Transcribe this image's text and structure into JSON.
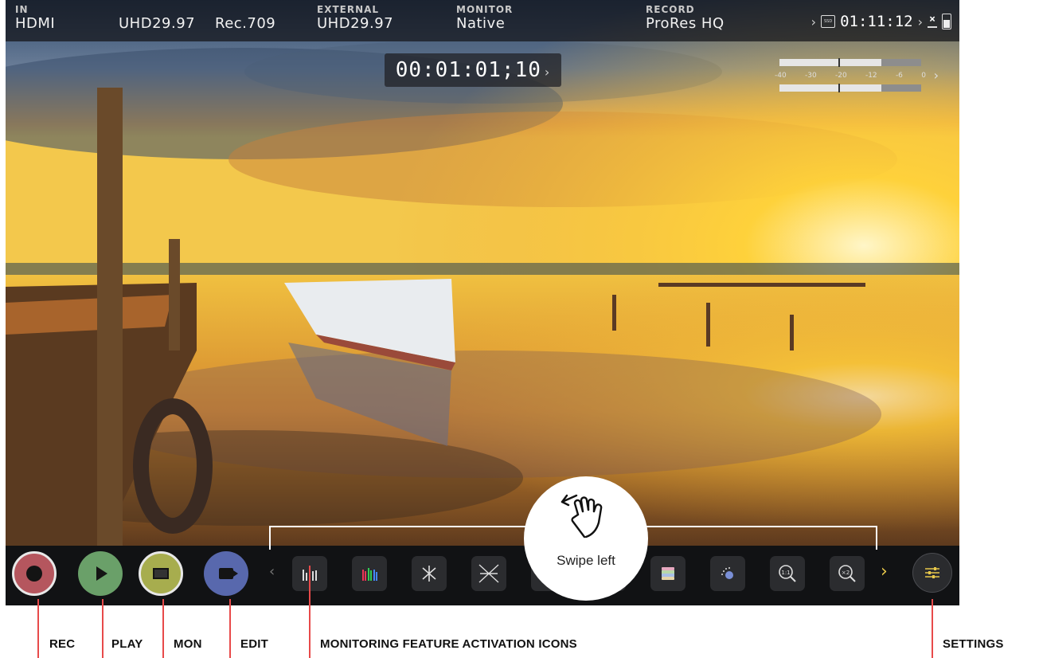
{
  "topbar": {
    "input": {
      "label": "IN",
      "value": "HDMI"
    },
    "format": {
      "value": "UHD29.97"
    },
    "gamma": {
      "value": "Rec.709"
    },
    "external": {
      "label": "EXTERNAL",
      "value": "UHD29.97"
    },
    "monitor": {
      "label": "MONITOR",
      "value": "Native"
    },
    "record": {
      "label": "RECORD",
      "value": "ProRes HQ"
    },
    "media": {
      "badge": "SSD",
      "remaining": "01:11:12"
    }
  },
  "timecode": {
    "value": "00:01:01;10"
  },
  "audio_meters": {
    "scale": [
      "-40",
      "-30",
      "-20",
      "-12",
      "-6",
      "0"
    ],
    "level_fraction": [
      0.72,
      0.72
    ]
  },
  "bottombar": {
    "modes": [
      {
        "id": "rec",
        "color": "#b5565e"
      },
      {
        "id": "play",
        "color": "#6aa069"
      },
      {
        "id": "mon",
        "color": "#a7ad4e"
      },
      {
        "id": "edit",
        "color": "#5868ad"
      }
    ],
    "monitoring_icons": [
      "waveform-icon",
      "vectorscope-rgb-icon",
      "false-color-icon",
      "zebra-icon",
      "histogram-icon",
      "focus-peaking-icon",
      "color-bars-icon",
      "dot-focus-icon",
      "zoom-1to1-icon",
      "zoom-x2-icon"
    ],
    "zoom_1_label": "1:1",
    "zoom_2_label": "×2"
  },
  "gesture": {
    "label": "Swipe left"
  },
  "annotations": {
    "rec": "REC",
    "play": "PLAY",
    "mon": "MON",
    "edit": "EDIT",
    "monitoring": "MONITORING FEATURE ACTIVATION ICONS",
    "settings": "SETTINGS"
  },
  "colors": {
    "annotation_line": "#e84a4a",
    "accent_chevron": "#e8c84a"
  }
}
